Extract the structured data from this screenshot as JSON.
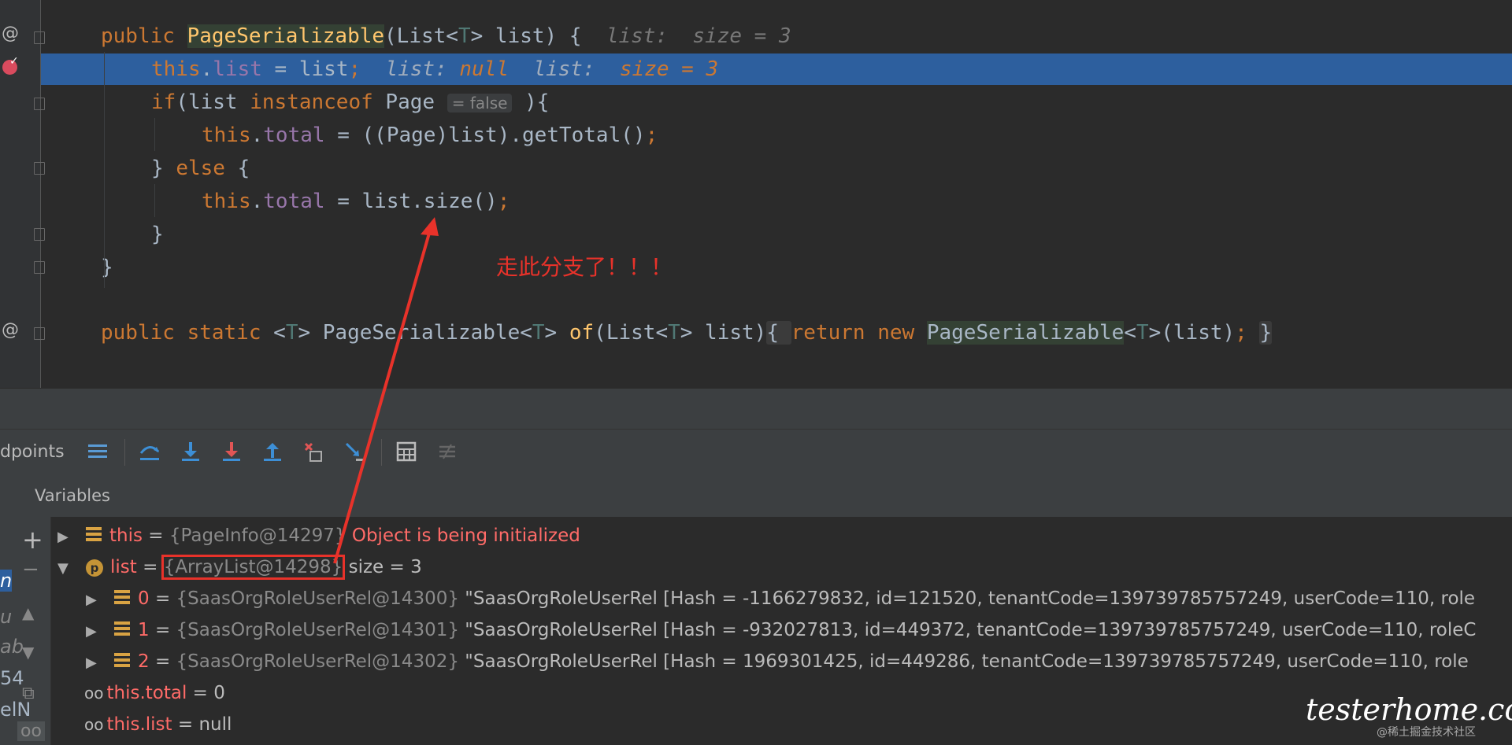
{
  "editor": {
    "lines": [
      {
        "kw1": "public ",
        "cls": "PageSerializable",
        "rest1": "(List<",
        "tp": "T",
        "rest2": "> list) {",
        "inline": "list:  size = 3"
      },
      {
        "kw": "this",
        "dot": ".",
        "fld": "list",
        "rest": " = list",
        "semi": ";",
        "inl1": "list: ",
        "inl1v": "null",
        "inl2": "list: ",
        "inl2v": "size = 3"
      },
      {
        "kw": "if",
        "rest1": "(list ",
        "kw2": "instanceof",
        "rest2": " Page",
        "badge": "= false",
        "rest3": "){"
      },
      {
        "kw": "this",
        "dot": ".",
        "fld": "total",
        "rest": " = ((Page)list).getTotal()",
        "semi": ";"
      },
      {
        "rest1": "} ",
        "kw": "else",
        "rest2": " {"
      },
      {
        "kw": "this",
        "dot": ".",
        "fld": "total",
        "rest": " = list.size()",
        "semi": ";"
      },
      {
        "rest": "}"
      },
      {
        "rest": "}"
      },
      {
        "kw1": "public static ",
        "lt": "<",
        "tp": "T",
        "gt": "> PageSerializable<",
        "tp2": "T",
        "gt2": "> ",
        "fn": "of",
        "rest1": "(List<",
        "tp3": "T",
        "rest2": "> list)",
        "fold1": "{ ",
        "kw2": "return new ",
        "cls": "PageSerializable",
        "lt2": "<",
        "tp4": "T",
        "rest3": ">(list)",
        "semi": ";",
        "fold2": "}"
      }
    ],
    "gutter_markers": [
      "@",
      "@"
    ],
    "annotation": "走此分支了！！！"
  },
  "toolbar": {
    "tab_label": "dpoints",
    "buttons": [
      "list-icon",
      "step-over-icon",
      "step-into-icon",
      "force-step-into-icon",
      "step-out-icon",
      "drop-frame-icon",
      "run-to-cursor-icon",
      "evaluate-icon",
      "trace-icon"
    ]
  },
  "variables": {
    "title": "Variables",
    "rows": [
      {
        "name": "this",
        "eq": " = ",
        "ref": "{PageInfo@14297}",
        "extra": " Object is being initialized"
      },
      {
        "name": "list",
        "eq": " = ",
        "ref": "{ArrayList@14298}",
        "extra": " size = 3"
      },
      {
        "name": "0",
        "eq": " = ",
        "ref": "{SaasOrgRoleUserRel@14300}",
        "extra": " \"SaasOrgRoleUserRel [Hash = -1166279832, id=121520, tenantCode=139739785757249, userCode=110, role"
      },
      {
        "name": "1",
        "eq": " = ",
        "ref": "{SaasOrgRoleUserRel@14301}",
        "extra": " \"SaasOrgRoleUserRel [Hash = -932027813, id=449372, tenantCode=139739785757249, userCode=110, roleC"
      },
      {
        "name": "2",
        "eq": " = ",
        "ref": "{SaasOrgRoleUserRel@14302}",
        "extra": " \"SaasOrgRoleUserRel [Hash = 1969301425, id=449286, tenantCode=139739785757249, userCode=110, role"
      },
      {
        "name": "this.total",
        "eq": " = ",
        "val": "0"
      },
      {
        "name": "this.list",
        "eq": " = ",
        "val": "null"
      }
    ]
  },
  "left_edge": [
    "n",
    "u",
    "ab",
    "54",
    "elN"
  ],
  "watermark": {
    "main": "testerhome.com",
    "sub": "@稀土掘金技术社区"
  },
  "colors": {
    "accent_blue": "#2d5f9e",
    "annotation_red": "#e8322a",
    "keyword": "#cc7832",
    "field": "#9876aa"
  }
}
